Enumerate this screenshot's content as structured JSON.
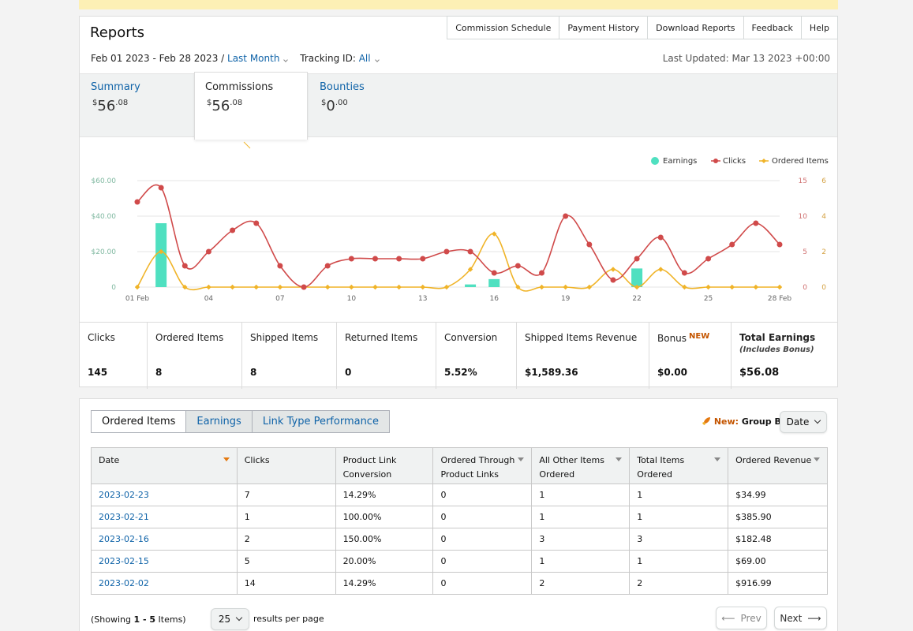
{
  "header": {
    "title": "Reports",
    "date_range": "Feb 01 2023 - Feb 28 2023 /",
    "period": "Last Month",
    "tracking_label": "Tracking ID:",
    "tracking_value": "All",
    "last_updated": "Last Updated: Mar 13 2023 +00:00",
    "nav": [
      "Commission Schedule",
      "Payment History",
      "Download Reports",
      "Feedback",
      "Help"
    ]
  },
  "summary_tabs": [
    {
      "label": "Summary",
      "currency": "$",
      "whole": "56",
      "cents": ".08"
    },
    {
      "label": "Commissions",
      "currency": "$",
      "whole": "56",
      "cents": ".08"
    },
    {
      "label": "Bounties",
      "currency": "$",
      "whole": "0",
      "cents": ".00"
    }
  ],
  "chart_data": {
    "type": "line",
    "legend": [
      "Earnings",
      "Clicks",
      "Ordered Items"
    ],
    "legend_position": "top-right",
    "colors": {
      "earnings": "#4fe0c0",
      "clicks": "#d04a4a",
      "ordered": "#f0b429"
    },
    "x_tick_labels": [
      "01 Feb",
      "04",
      "07",
      "10",
      "13",
      "16",
      "19",
      "22",
      "25",
      "28 Feb"
    ],
    "x_tick_days": [
      1,
      4,
      7,
      10,
      13,
      16,
      19,
      22,
      25,
      28
    ],
    "y_left_ticks": [
      "$60.00",
      "$40.00",
      "$20.00",
      "0"
    ],
    "y_left_range": [
      0,
      60
    ],
    "y_right_clicks_ticks": [
      "15",
      "10",
      "5",
      "0"
    ],
    "y_right_clicks_range": [
      0,
      15
    ],
    "y_right_ordered_ticks": [
      "6",
      "4",
      "2",
      "0"
    ],
    "y_right_ordered_range": [
      0,
      6
    ],
    "grid": true,
    "days": [
      1,
      2,
      3,
      4,
      5,
      6,
      7,
      8,
      9,
      10,
      11,
      12,
      13,
      14,
      15,
      16,
      17,
      18,
      19,
      20,
      21,
      22,
      23,
      24,
      25,
      26,
      27,
      28
    ],
    "series": [
      {
        "name": "Clicks",
        "values": [
          12,
          14,
          3,
          5,
          8,
          9,
          3,
          0,
          3,
          4,
          4,
          4,
          4,
          5,
          5,
          2,
          3,
          2,
          10,
          6,
          1,
          4,
          7,
          2,
          4,
          6,
          9,
          6
        ]
      },
      {
        "name": "Ordered Items",
        "values": [
          0,
          2,
          0,
          0,
          0,
          0,
          0,
          0,
          0,
          0,
          0,
          0,
          0,
          0,
          1,
          3,
          0,
          0,
          0,
          0,
          1,
          0,
          1,
          0,
          0,
          0,
          0,
          0
        ]
      },
      {
        "name": "Earnings",
        "values": [
          0,
          36,
          0,
          0,
          0,
          0,
          0,
          0,
          0,
          0,
          0,
          0,
          0,
          0,
          1.5,
          4.5,
          0,
          0,
          0,
          0,
          0,
          10.5,
          0,
          0,
          0,
          0,
          0,
          0
        ]
      }
    ]
  },
  "metrics": [
    {
      "label": "Clicks",
      "value": "145"
    },
    {
      "label": "Ordered Items",
      "value": "8"
    },
    {
      "label": "Shipped Items",
      "value": "8"
    },
    {
      "label": "Returned Items",
      "value": "0"
    },
    {
      "label": "Conversion",
      "value": "5.52%"
    },
    {
      "label": "Shipped Items Revenue",
      "value": "$1,589.36"
    },
    {
      "label": "Bonus",
      "badge": "NEW",
      "value": "$0.00"
    },
    {
      "label": "Total Earnings",
      "sublabel": "(Includes Bonus)",
      "value": "$56.08"
    }
  ],
  "table_section": {
    "tabs": [
      "Ordered Items",
      "Earnings",
      "Link Type Performance"
    ],
    "group_by_new": "New:",
    "group_by_label": "Group By:",
    "group_by_value": "Date",
    "columns": [
      [
        "Date"
      ],
      [
        "Clicks"
      ],
      [
        "Product Link",
        "Conversion"
      ],
      [
        "Ordered Through",
        "Product Links"
      ],
      [
        "All Other Items",
        "Ordered"
      ],
      [
        "Total Items",
        "Ordered"
      ],
      [
        "Ordered Revenue"
      ]
    ],
    "rows": [
      [
        "2023-02-23",
        "7",
        "14.29%",
        "0",
        "1",
        "1",
        "$34.99"
      ],
      [
        "2023-02-21",
        "1",
        "100.00%",
        "0",
        "1",
        "1",
        "$385.90"
      ],
      [
        "2023-02-16",
        "2",
        "150.00%",
        "0",
        "3",
        "3",
        "$182.48"
      ],
      [
        "2023-02-15",
        "5",
        "20.00%",
        "0",
        "1",
        "1",
        "$69.00"
      ],
      [
        "2023-02-02",
        "14",
        "14.29%",
        "0",
        "2",
        "2",
        "$916.99"
      ]
    ],
    "showing_prefix": "(Showing ",
    "showing_range": "1 - 5",
    "showing_suffix": " Items)",
    "per_page": "25",
    "per_page_label": "results per page",
    "prev": "Prev",
    "next": "Next"
  }
}
